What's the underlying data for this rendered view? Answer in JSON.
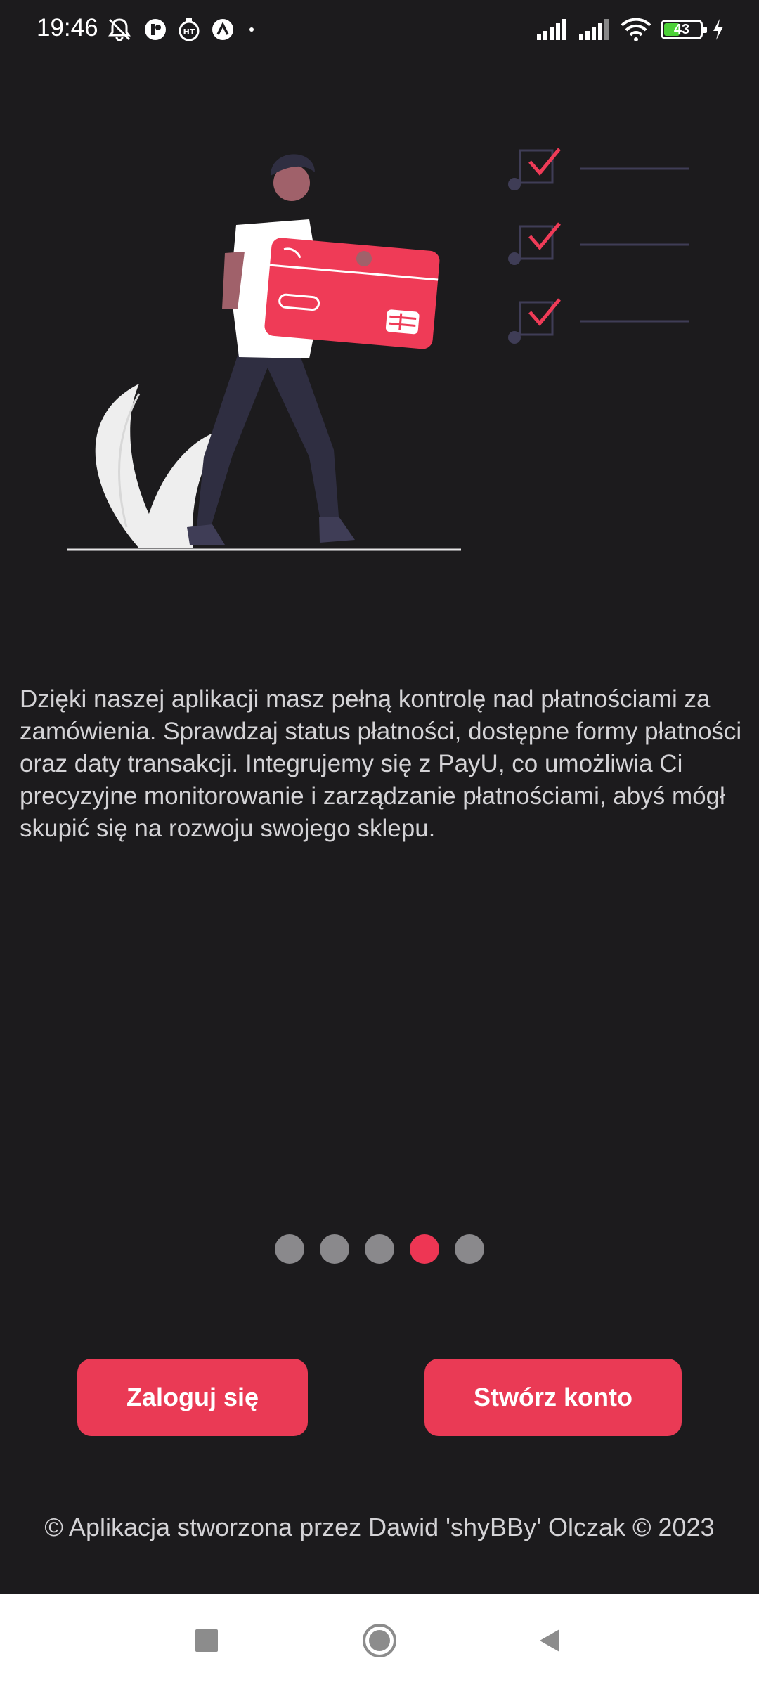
{
  "status_bar": {
    "time": "19:46",
    "battery_percent": "43",
    "icons_left": [
      "muted-notifications-icon",
      "app-badge-icon",
      "stopwatch-icon",
      "up-arrow-app-icon",
      "dot-icon"
    ],
    "icons_right": [
      "signal-1-icon",
      "signal-2-icon",
      "wifi-icon",
      "battery-icon",
      "charging-icon"
    ]
  },
  "onboarding": {
    "illustration": "person-holding-credit-card-checklist",
    "description": "Dzięki naszej aplikacji masz pełną kontrolę nad płatnościami za zamówienia. Sprawdzaj status płatności, dostępne formy płatności oraz daty transakcji. Integrujemy się z PayU, co umożliwia Ci precyzyjne monitorowanie i zarządzanie płatnościami, abyś mógł skupić się na rozwoju swojego sklepu.",
    "pages_total": 5,
    "current_page": 4
  },
  "buttons": {
    "login": "Zaloguj się",
    "register": "Stwórz konto"
  },
  "footer": {
    "text": "© Aplikacja stworzona przez Dawid 'shyBBy' Olczak © 2023"
  },
  "colors": {
    "background": "#1c1b1d",
    "accent": "#ea3a55",
    "dot_inactive": "#8a898c",
    "navbar": "#ffffff"
  },
  "nav_bar": {
    "items": [
      "recents-square-icon",
      "home-circle-icon",
      "back-triangle-icon"
    ]
  }
}
